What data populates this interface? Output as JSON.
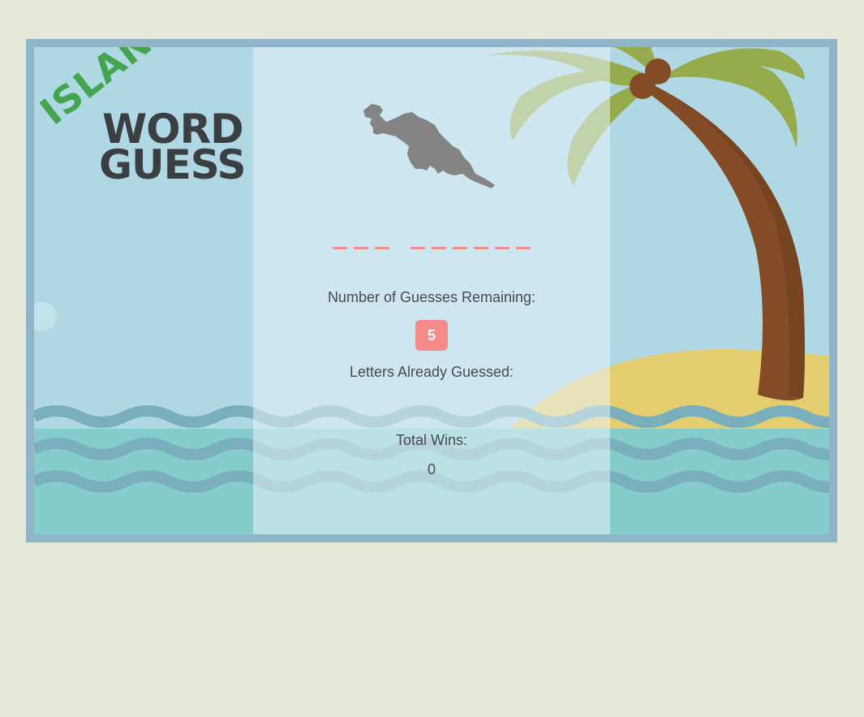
{
  "logo": {
    "line1": "ISLAND",
    "line2": "WORD",
    "line3": "GUESS"
  },
  "game": {
    "word_blanks": [
      3,
      6
    ],
    "guesses_label": "Number of Guesses Remaining:",
    "guesses_remaining": "5",
    "letters_label": "Letters Already Guessed:",
    "letters_guessed": "",
    "wins_label": "Total Wins:",
    "total_wins": "0"
  },
  "colors": {
    "page_background": "#e6e8d9",
    "frame": "#8fb4c8",
    "sky": "#afd8e4",
    "water": "#86cccc",
    "waves": "#7aafbd",
    "sand": "#e4cd6e",
    "trunk": "#834c26",
    "leaves": "#95ab4c",
    "logo_green": "#43a54f",
    "logo_dark": "#3c3f42",
    "blank": "#f09090",
    "badge": "#f58a8a"
  },
  "icons": {
    "island_silhouette": "island-map-icon",
    "palm_tree": "palm-tree-icon"
  }
}
